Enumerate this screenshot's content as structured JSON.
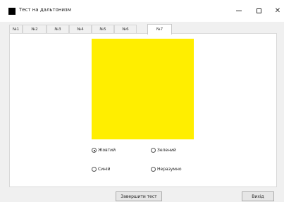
{
  "window": {
    "title": "Тест на дальтонизм",
    "close_glyph": "✕"
  },
  "tabs": [
    {
      "label": "№1",
      "active": false
    },
    {
      "label": "№2",
      "active": false
    },
    {
      "label": "№3",
      "active": false
    },
    {
      "label": "№4",
      "active": false
    },
    {
      "label": "№5",
      "active": false
    },
    {
      "label": "№6",
      "active": false
    },
    {
      "label": "№7",
      "active": true
    }
  ],
  "test": {
    "color": "#ffee00",
    "options": [
      {
        "label": "Жовтий",
        "selected": true
      },
      {
        "label": "Зелений",
        "selected": false
      },
      {
        "label": "Синій",
        "selected": false
      },
      {
        "label": "Неразумно",
        "selected": false
      }
    ]
  },
  "buttons": {
    "finish": "Завершити тест",
    "exit": "Вихід"
  }
}
